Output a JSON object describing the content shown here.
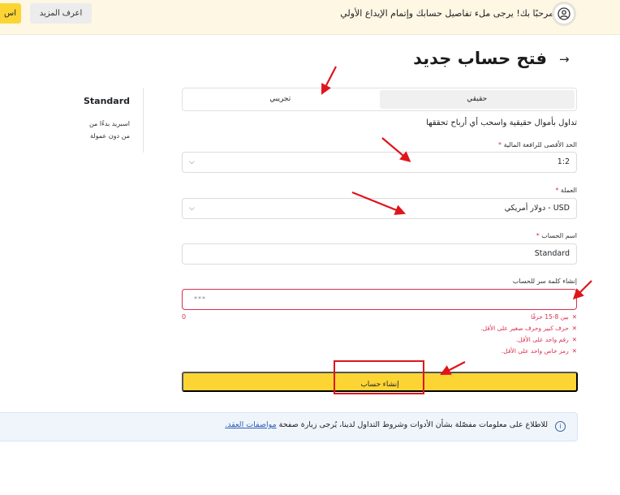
{
  "banner": {
    "text": "مرحبًا بك! يرجى ملء تفاصيل حسابك وإتمام الإيداع الأولي",
    "learn_more": "اعرف المزيد",
    "cut_button": "اس"
  },
  "page": {
    "title": "فتح حساب جديد"
  },
  "tabs": [
    {
      "label": "تجريبي",
      "active": false
    },
    {
      "label": "حقيقي",
      "active": true
    }
  ],
  "subtitle": "تداول بأموال حقيقية واسحب أي أرباح تحققها",
  "form": {
    "leverage": {
      "label": "الحد الأقصى للرافعة المالية",
      "required": "*",
      "value": "1:2"
    },
    "currency": {
      "label": "العملة",
      "required": "*",
      "value": "USD - دولار أمريكي"
    },
    "account_name": {
      "label": "اسم الحساب",
      "required": "*",
      "value": "Standard"
    },
    "password": {
      "label": "إنشاء كلمة سر للحساب",
      "placeholder": "***",
      "counter": "0"
    },
    "password_rules": [
      "بين 8-15 حرفًا",
      "حرف كبير وحرف صغير على الأقل.",
      "رقم واحد على الأقل.",
      "رمز خاص واحد على الأقل."
    ],
    "submit_label": "إنشاء حساب"
  },
  "info": {
    "text": "للاطلاع على معلومات مفصّلة بشأن الأدوات وشروط التداول لدينا، يُرجى زيارة صفحة",
    "link": "مواصفات العقد."
  },
  "side_panel": {
    "title": "Standard",
    "line1": "اسبريد بدءًا من",
    "line2": "من دون عمولة"
  },
  "colors": {
    "accent": "#fcd535",
    "error": "#d9304e",
    "annotation": "#e0141c"
  }
}
